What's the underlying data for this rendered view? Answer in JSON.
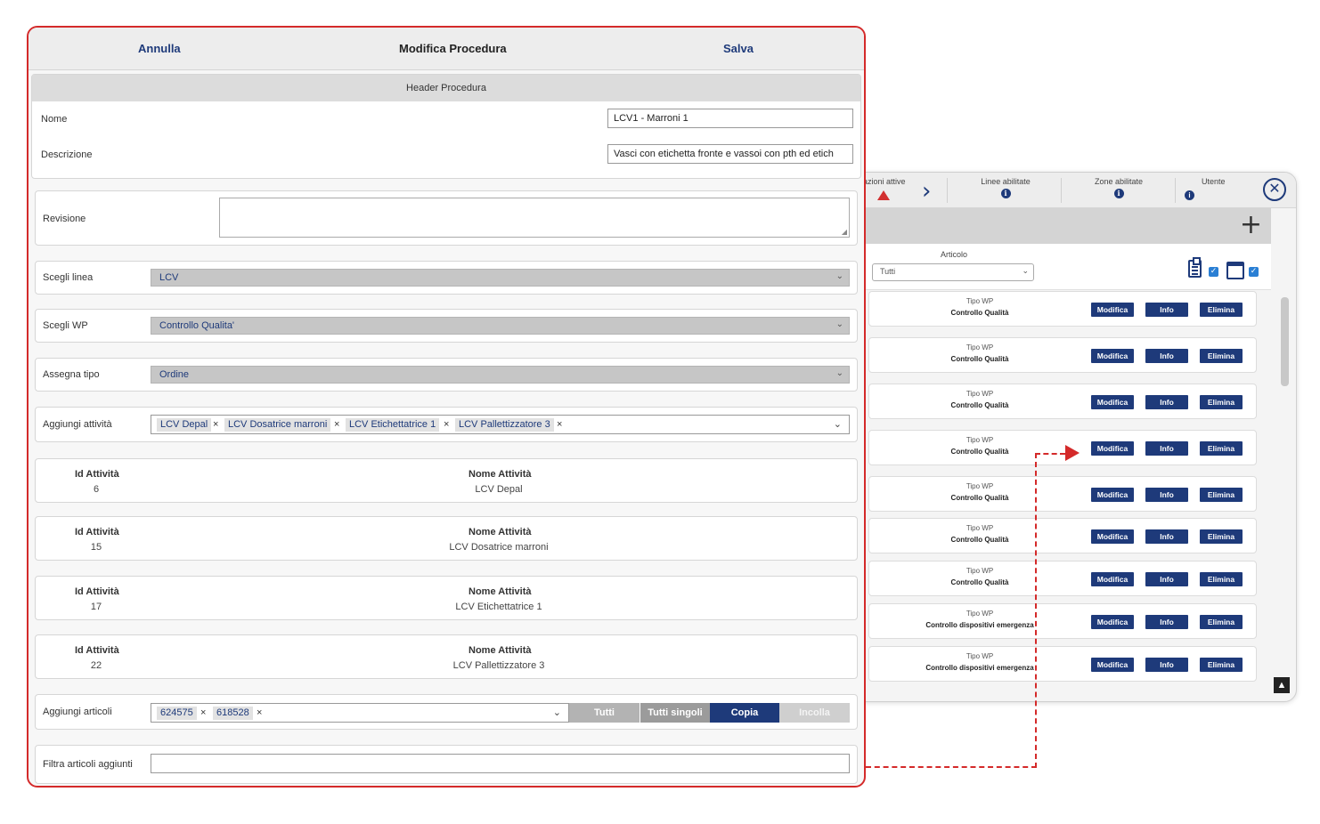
{
  "background_window": {
    "columns": {
      "operations": "azioni attive",
      "lines": "Linee abilitate",
      "zones": "Zone abilitate",
      "user": "Utente"
    },
    "info_glyph": "i",
    "close_glyph": "✕",
    "add_glyph": "+",
    "article_label": "Articolo",
    "article_value": "Tutti",
    "up_glyph": "▲",
    "rows": [
      {
        "type_label": "Tipo WP",
        "type_value": "Controllo Qualità",
        "modify": "Modifica",
        "info": "Info",
        "delete": "Elimina"
      },
      {
        "type_label": "Tipo WP",
        "type_value": "Controllo Qualità",
        "modify": "Modifica",
        "info": "Info",
        "delete": "Elimina"
      },
      {
        "type_label": "Tipo WP",
        "type_value": "Controllo Qualità",
        "modify": "Modifica",
        "info": "Info",
        "delete": "Elimina"
      },
      {
        "type_label": "Tipo WP",
        "type_value": "Controllo Qualità",
        "modify": "Modifica",
        "info": "Info",
        "delete": "Elimina"
      },
      {
        "type_label": "Tipo WP",
        "type_value": "Controllo Qualità",
        "modify": "Modifica",
        "info": "Info",
        "delete": "Elimina"
      },
      {
        "type_label": "Tipo WP",
        "type_value": "Controllo Qualità",
        "modify": "Modifica",
        "info": "Info",
        "delete": "Elimina"
      },
      {
        "type_label": "Tipo WP",
        "type_value": "Controllo Qualità",
        "modify": "Modifica",
        "info": "Info",
        "delete": "Elimina"
      },
      {
        "type_label": "Tipo WP",
        "type_value": "Controllo dispositivi emergenza",
        "modify": "Modifica",
        "info": "Info",
        "delete": "Elimina"
      },
      {
        "type_label": "Tipo WP",
        "type_value": "Controllo dispositivi emergenza",
        "modify": "Modifica",
        "info": "Info",
        "delete": "Elimina"
      }
    ]
  },
  "dialog": {
    "cancel": "Annulla",
    "title": "Modifica Procedura",
    "save": "Salva",
    "header": {
      "title": "Header Procedura",
      "name_label": "Nome",
      "name_value": "LCV1 - Marroni 1",
      "desc_label": "Descrizione",
      "desc_value": "Vasci con etichetta fronte e vassoi con pth ed etich"
    },
    "revision_label": "Revisione",
    "line": {
      "label": "Scegli linea",
      "value": "LCV"
    },
    "wp": {
      "label": "Scegli WP",
      "value": "Controllo Qualita'"
    },
    "assign": {
      "label": "Assegna tipo",
      "value": "Ordine"
    },
    "activities": {
      "label": "Aggiungi attività",
      "chips": [
        "LCV Depal",
        "LCV Dosatrice marroni",
        "LCV Etichettatrice 1",
        "LCV Pallettizzatore 3"
      ]
    },
    "chip_remove": "×",
    "dropdown_arrow": "⌄",
    "activity_cards": [
      {
        "id_label": "Id Attività",
        "id": "6",
        "name_label": "Nome Attività",
        "name": "LCV Depal"
      },
      {
        "id_label": "Id Attività",
        "id": "15",
        "name_label": "Nome Attività",
        "name": "LCV Dosatrice marroni"
      },
      {
        "id_label": "Id Attività",
        "id": "17",
        "name_label": "Nome Attività",
        "name": "LCV Etichettatrice 1"
      },
      {
        "id_label": "Id Attività",
        "id": "22",
        "name_label": "Nome Attività",
        "name": "LCV Pallettizzatore 3"
      }
    ],
    "articles": {
      "label": "Aggiungi articoli",
      "chips": [
        "624575",
        "618528"
      ],
      "buttons": {
        "all": "Tutti",
        "all_single": "Tutti singoli",
        "copy": "Copia",
        "paste": "Incolla"
      }
    },
    "filter_label": "Filtra articoli aggiunti",
    "filter_value": ""
  },
  "colors": {
    "accent": "#1e3a7a",
    "highlight": "#d42a2a"
  }
}
